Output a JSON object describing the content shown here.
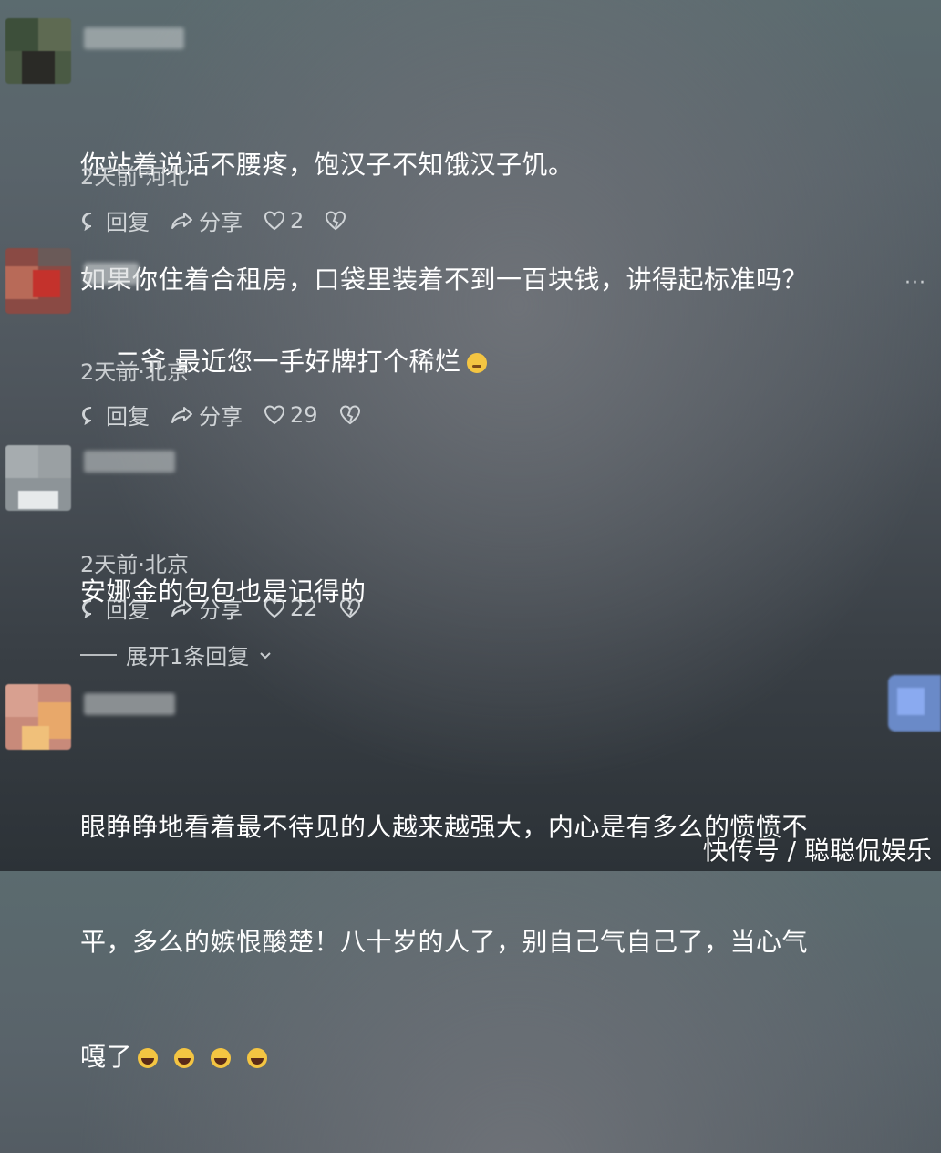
{
  "comments": [
    {
      "lines": [
        "你站着说话不腰疼，饱汉子不知饿汉子饥。",
        "如果你住着合租房，口袋里装着不到一百块钱，讲得起标准吗？"
      ],
      "meta": "2天前·河北",
      "reply_label": "回复",
      "share_label": "分享",
      "likes": "2"
    },
    {
      "lines": [
        "二爷 最近您一手好牌打个稀烂"
      ],
      "meta": "2天前·北京",
      "reply_label": "回复",
      "share_label": "分享",
      "likes": "29"
    },
    {
      "lines": [
        "安娜金的包包也是记得的"
      ],
      "meta": "2天前·北京",
      "reply_label": "回复",
      "share_label": "分享",
      "likes": "22",
      "expand_label": "展开1条回复"
    },
    {
      "lines": [
        "眼睁睁地看着最不待见的人越来越强大，内心是有多么的愤愤不",
        "平，多么的嫉恨酸楚！八十岁的人了，别自己气自己了，当心气",
        "嘎了"
      ]
    }
  ],
  "more_label": "···",
  "watermark": "快传号 / 聪聪侃娱乐",
  "icons": [
    "comment-icon",
    "share-icon",
    "heart-icon",
    "broken-heart-icon",
    "laugh-emoji",
    "thinking-emoji",
    "more-icon",
    "chevron-down-icon"
  ]
}
